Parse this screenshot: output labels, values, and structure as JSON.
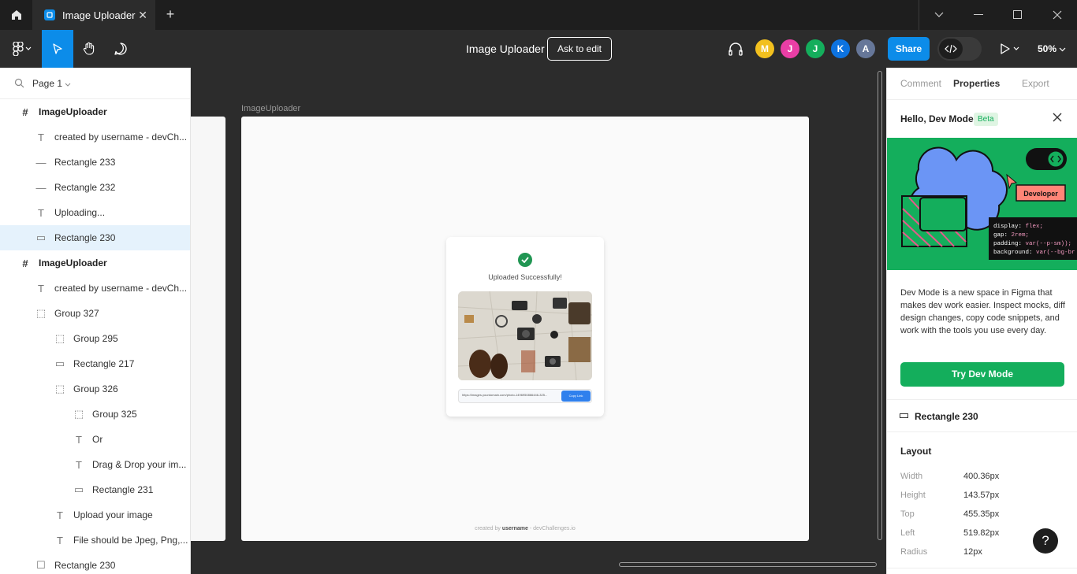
{
  "app": {
    "tab_title": "Image Uploader",
    "file_title": "Image Uploader",
    "ask_to_edit": "Ask to edit",
    "share_label": "Share",
    "zoom": "50%"
  },
  "avatars": [
    {
      "initial": "M",
      "color": "#f2c01e"
    },
    {
      "initial": "J",
      "color": "#e93ea5"
    },
    {
      "initial": "J",
      "color": "#14ae5c"
    },
    {
      "initial": "K",
      "color": "#0d73e0"
    },
    {
      "initial": "A",
      "color": "#667799"
    }
  ],
  "layers": {
    "page": "Page 1",
    "items": [
      {
        "label": "ImageUploader",
        "icon": "frame-icon",
        "frame": true
      },
      {
        "label": "created by username - devCh...",
        "icon": "text-icon"
      },
      {
        "label": "Rectangle 233",
        "icon": "line-icon"
      },
      {
        "label": "Rectangle 232",
        "icon": "line-icon"
      },
      {
        "label": "Uploading...",
        "icon": "text-icon"
      },
      {
        "label": "Rectangle 230",
        "icon": "rectangle-icon",
        "selected": true
      },
      {
        "label": "ImageUploader",
        "icon": "frame-icon",
        "frame": true
      },
      {
        "label": "created by username - devCh...",
        "icon": "text-icon"
      },
      {
        "label": "Group 327",
        "icon": "group-icon"
      },
      {
        "label": "Group 295",
        "icon": "group-icon"
      },
      {
        "label": "Rectangle 217",
        "icon": "rectangle-icon"
      },
      {
        "label": "Group 326",
        "icon": "group-icon"
      },
      {
        "label": "Group 325",
        "icon": "group-icon"
      },
      {
        "label": "Or",
        "icon": "text-icon"
      },
      {
        "label": "Drag & Drop your im...",
        "icon": "text-icon"
      },
      {
        "label": "Rectangle 231",
        "icon": "rectangle-icon"
      },
      {
        "label": "Upload your image",
        "icon": "text-icon"
      },
      {
        "label": "File should be Jpeg, Png,...",
        "icon": "text-icon"
      },
      {
        "label": "Rectangle 230",
        "icon": "square-icon"
      }
    ]
  },
  "canvas": {
    "frame_label": "ImageUploader",
    "card_title": "Uploaded Successfully!",
    "link_url": "https://images.yourdomain.com/photo-1496950866446-325...",
    "copy_label": "Copy Link",
    "footer_prefix": "created by ",
    "footer_user": "username",
    "footer_suffix": " - devChallenges.io"
  },
  "inspector": {
    "tabs": [
      "Comment",
      "Properties",
      "Export"
    ],
    "active_tab": "Properties",
    "hello": "Hello, Dev Mode",
    "beta": "Beta",
    "developer_tag": "Developer",
    "code_lines": [
      {
        "key": "display",
        "value": "flex;"
      },
      {
        "key": "gap",
        "value": "2rem;"
      },
      {
        "key": "padding",
        "value": "var(--p-sm));"
      },
      {
        "key": "background",
        "value": "var(--bg-br"
      }
    ],
    "description": "Dev Mode is a new space in Figma that makes dev work easier. Inspect mocks, diff design changes, copy code snippets, and work with the tools you use every day.",
    "try_button": "Try Dev Mode",
    "selected_layer": "Rectangle 230",
    "layout_heading": "Layout",
    "properties": [
      {
        "key": "Width",
        "value": "400.36px"
      },
      {
        "key": "Height",
        "value": "143.57px"
      },
      {
        "key": "Top",
        "value": "455.35px"
      },
      {
        "key": "Left",
        "value": "519.82px"
      },
      {
        "key": "Radius",
        "value": "12px"
      }
    ],
    "help": "?"
  },
  "colors": {
    "accent": "#0c8ce9",
    "dev_green": "#14ae5c",
    "success": "#219653",
    "copy_button": "#2f80ed"
  }
}
